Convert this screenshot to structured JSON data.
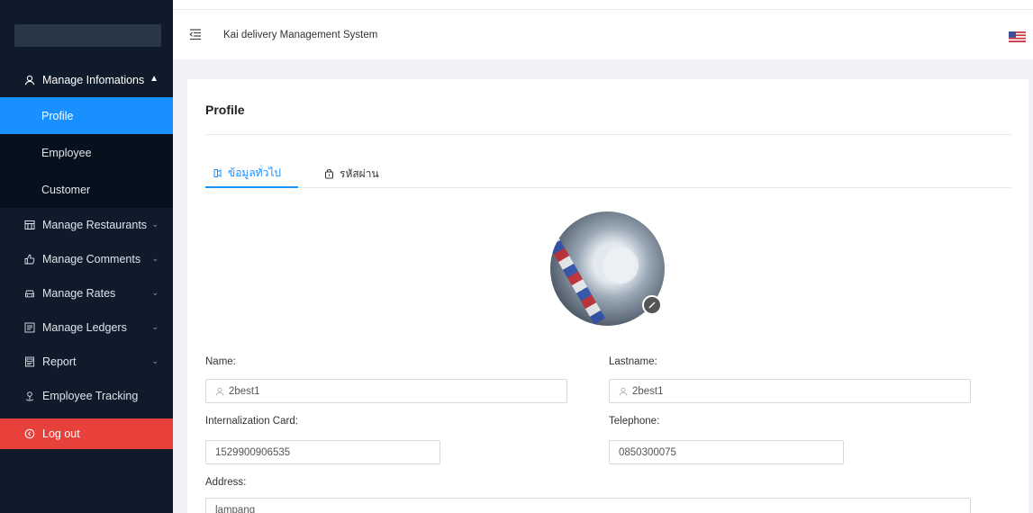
{
  "header": {
    "app_title": "Kai delivery Management System"
  },
  "sidebar": {
    "manage_info": "Manage Infomations",
    "sub_items": [
      "Profile",
      "Employee",
      "Customer"
    ],
    "items": [
      {
        "label": "Manage Restaurants",
        "icon": "restaurant-icon"
      },
      {
        "label": "Manage Comments",
        "icon": "thumbs-up-icon"
      },
      {
        "label": "Manage Rates",
        "icon": "car-icon"
      },
      {
        "label": "Manage Ledgers",
        "icon": "ledger-icon"
      },
      {
        "label": "Report",
        "icon": "report-icon"
      },
      {
        "label": "Employee Tracking",
        "icon": "location-icon"
      }
    ],
    "logout": "Log out"
  },
  "page": {
    "title": "Profile",
    "tabs": [
      "ข้อมูลทั่วไป",
      "รหัสผ่าน"
    ]
  },
  "form": {
    "name_label": "Name:",
    "name_value": "2best1",
    "lastname_label": "Lastname:",
    "lastname_value": "2best1",
    "card_label": "Internalization Card:",
    "card_value": "1529900906535",
    "phone_label": "Telephone:",
    "phone_value": "0850300075",
    "address_label": "Address:",
    "address_value": "lampang"
  },
  "colors": {
    "accent": "#1890ff",
    "sidebar": "#0f1b2b",
    "logout": "#e8403b"
  }
}
